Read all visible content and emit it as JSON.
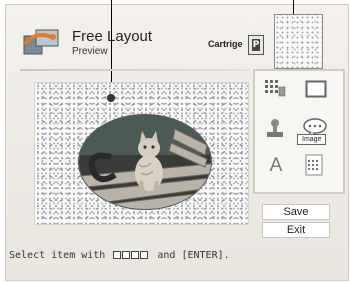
{
  "header": {
    "title": "Free Layout",
    "subtitle": "Preview",
    "cartridge_label": "Cartrige",
    "cartridge_letter": "P"
  },
  "palette": {
    "tooltip": "Image",
    "tools": [
      {
        "icon": "image-grid-icon"
      },
      {
        "icon": "frame-icon"
      },
      {
        "icon": "stamp-icon"
      },
      {
        "icon": "speech-bubble-icon"
      },
      {
        "icon": "text-icon"
      },
      {
        "icon": "calendar-icon"
      }
    ]
  },
  "buttons": {
    "save": "Save",
    "exit": "Exit"
  },
  "status": {
    "prefix": "Select item with",
    "suffix": "and [ENTER]."
  }
}
